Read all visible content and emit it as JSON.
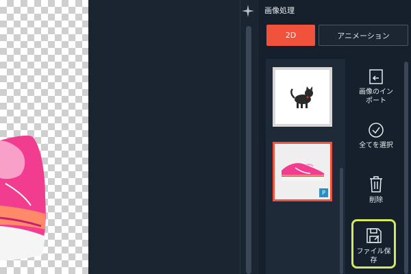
{
  "panel": {
    "title": "画像処理",
    "tabs": [
      {
        "label": "2D",
        "active": true
      },
      {
        "label": "アニメーション",
        "active": false
      }
    ]
  },
  "thumbnails": [
    {
      "name": "cat-image",
      "selected": false
    },
    {
      "name": "shoe-image",
      "selected": true,
      "badge": "P"
    }
  ],
  "tools": {
    "import": {
      "label_line1": "画像のイン",
      "label_line2": "ポート"
    },
    "select_all": {
      "label": "全てを選択"
    },
    "delete": {
      "label": "削除"
    },
    "save": {
      "label": "ファイル保存"
    }
  },
  "colors": {
    "accent": "#f0523c",
    "highlight": "#d6e95a",
    "background": "#1b2431"
  }
}
